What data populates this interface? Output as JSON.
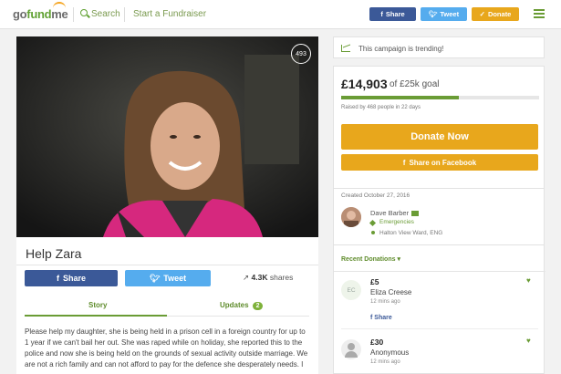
{
  "header": {
    "logo": {
      "go": "go",
      "fund": "fund",
      "me": "me"
    },
    "search_label": "Search",
    "start_fundraiser": "Start a Fundraiser",
    "share_label": "Share",
    "tweet_label": "Tweet",
    "donate_label": "Donate"
  },
  "campaign": {
    "heart_count": "493",
    "title": "Help Zara",
    "share_label": "Share",
    "tweet_label": "Tweet",
    "shares_count": "4.3K",
    "shares_text": "shares",
    "tabs": {
      "story": "Story",
      "updates": "Updates",
      "updates_count": "2"
    },
    "story": "Please help my daughter, she is being held in a prison cell in a foreign country for up to 1 year if we can't bail her out. She was raped while on holiday, she reported this to the police and now she is being held on the grounds of sexual activity outside marriage. We are not a rich family and can not afford to pay for the defence she desperately needs. I"
  },
  "trending": {
    "text": "This campaign is trending!"
  },
  "funding": {
    "amount": "£14,903",
    "goal_text": "of £25k goal",
    "progress_fraction": 0.596,
    "raised_text": "Raised by 468 people in 22 days",
    "donate_now": "Donate Now",
    "share_facebook": "Share on Facebook"
  },
  "organizer": {
    "created": "Created October 27, 2016",
    "name": "Dave Barber",
    "category": "Emergencies",
    "location": "Halton View Ward, ENG"
  },
  "donations": {
    "heading": "Recent Donations",
    "items": [
      {
        "initials": "EC",
        "amount": "£5",
        "name": "Eliza Creese",
        "time": "12 mins ago",
        "share": "Share"
      },
      {
        "initials": "",
        "amount": "£30",
        "name": "Anonymous",
        "time": "12 mins ago"
      }
    ]
  },
  "colors": {
    "green": "#6a9c35",
    "orange": "#e8a71c",
    "facebook": "#3b5998",
    "twitter": "#55acee"
  }
}
